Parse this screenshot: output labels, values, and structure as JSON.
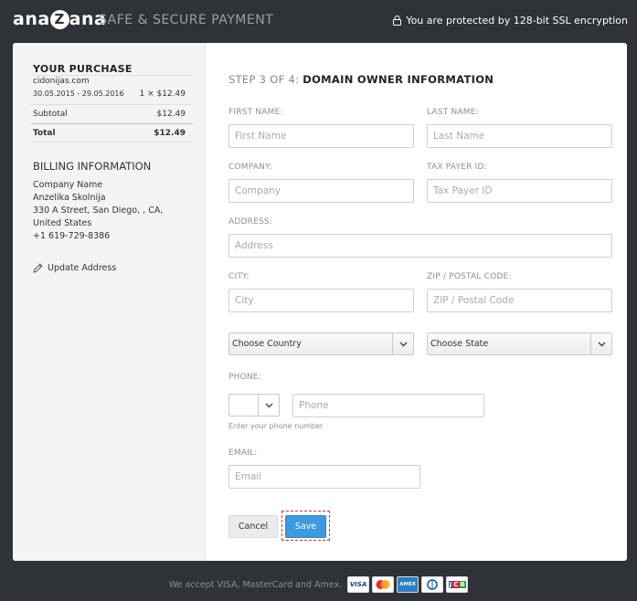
{
  "header": {
    "brand_pre": "ana",
    "brand_z": "Z",
    "brand_post": "ana",
    "tagline": "SAFE & SECURE PAYMENT",
    "ssl_text": "You are protected by 128-bit SSL encryption"
  },
  "purchase": {
    "title": "YOUR PURCHASE",
    "domain": "cidonijas.com",
    "period": "30.05.2015 - 29.05.2016",
    "qty_price": "1 × $12.49",
    "subtotal_label": "Subtotal",
    "subtotal_value": "$12.49",
    "total_label": "Total",
    "total_value": "$12.49"
  },
  "billing": {
    "title": "BILLING INFORMATION",
    "company": "Company Name",
    "name": "Anzelika Skolnija",
    "address": "330 A Street, San Diego, , CA, United States",
    "phone": "+1 619-729-8386",
    "update_label": "Update Address"
  },
  "form": {
    "step_prefix": "STEP 3 OF 4:",
    "step_title": "DOMAIN OWNER INFORMATION",
    "first_name": {
      "label": "FIRST NAME:",
      "placeholder": "First Name",
      "value": ""
    },
    "last_name": {
      "label": "LAST NAME:",
      "placeholder": "Last Name",
      "value": ""
    },
    "company": {
      "label": "COMPANY:",
      "placeholder": "Company",
      "value": ""
    },
    "tax_id": {
      "label": "TAX PAYER ID:",
      "placeholder": "Tax Payer ID",
      "value": ""
    },
    "address": {
      "label": "ADDRESS:",
      "placeholder": "Address",
      "value": ""
    },
    "city": {
      "label": "CITY:",
      "placeholder": "City",
      "value": ""
    },
    "zip": {
      "label": "ZIP / POSTAL CODE:",
      "placeholder": "ZIP / Postal Code",
      "value": ""
    },
    "country_select": "Choose Country",
    "state_select": "Choose State",
    "phone": {
      "label": "PHONE:",
      "placeholder": "Phone",
      "hint": "Enter your phone number",
      "code": ""
    },
    "email": {
      "label": "EMAIL:",
      "placeholder": "Email",
      "value": ""
    },
    "cancel_label": "Cancel",
    "save_label": "Save"
  },
  "footer": {
    "text": "We accept VISA, MasterCard and Amex.",
    "cards": [
      "VISA",
      "MC",
      "AMEX",
      "DC",
      "JCB"
    ]
  },
  "colors": {
    "background": "#2f3236",
    "accent": "#3d9ae0",
    "highlight": "#d0342c"
  }
}
